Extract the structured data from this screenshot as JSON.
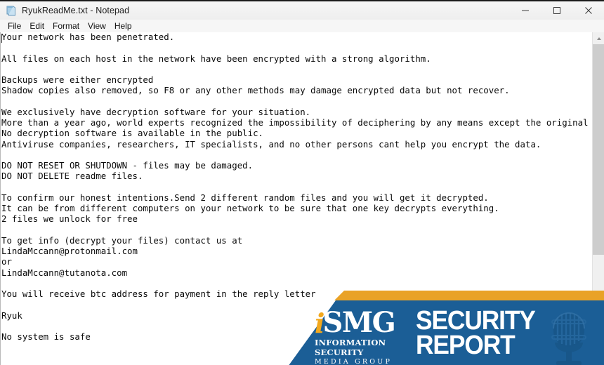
{
  "window": {
    "title": "RyukReadMe.txt - Notepad",
    "icon": "notepad-document-icon",
    "controls": {
      "minimize": "minimize-icon",
      "maximize": "maximize-icon",
      "close": "close-icon"
    }
  },
  "menu": {
    "items": [
      {
        "label": "File"
      },
      {
        "label": "Edit"
      },
      {
        "label": "Format"
      },
      {
        "label": "View"
      },
      {
        "label": "Help"
      }
    ]
  },
  "document": {
    "content": "Your network has been penetrated.\n\nAll files on each host in the network have been encrypted with a strong algorithm.\n\nBackups were either encrypted\nShadow copies also removed, so F8 or any other methods may damage encrypted data but not recover.\n\nWe exclusively have decryption software for your situation.\nMore than a year ago, world experts recognized the impossibility of deciphering by any means except the original decoder.\nNo decryption software is available in the public.\nAntiviruse companies, researchers, IT specialists, and no other persons cant help you encrypt the data.\n\nDO NOT RESET OR SHUTDOWN - files may be damaged.\nDO NOT DELETE readme files.\n\nTo confirm our honest intentions.Send 2 different random files and you will get it decrypted.\nIt can be from different computers on your network to be sure that one key decrypts everything.\n2 files we unlock for free\n\nTo get info (decrypt your files) contact us at\nLindaMccann@protonmail.com\nor\nLindaMccann@tutanota.com\n\nYou will receive btc address for payment in the reply letter\n\nRyuk\n\nNo system is safe",
    "lines": [
      "Your network has been penetrated.",
      "",
      "All files on each host in the network have been encrypted with a strong algorithm.",
      "",
      "Backups were either encrypted",
      "Shadow copies also removed, so F8 or any other methods may damage encrypted data but not recover.",
      "",
      "We exclusively have decryption software for your situation.",
      "More than a year ago, world experts recognized the impossibility of deciphering by any means except the original decoder.",
      "No decryption software is available in the public.",
      "Antiviruse companies, researchers, IT specialists, and no other persons cant help you encrypt the data.",
      "",
      "DO NOT RESET OR SHUTDOWN - files may be damaged.",
      "DO NOT DELETE readme files.",
      "",
      "To confirm our honest intentions.Send 2 different random files and you will get it decrypted.",
      "It can be from different computers on your network to be sure that one key decrypts everything.",
      "2 files we unlock for free",
      "",
      "To get info (decrypt your files) contact us at",
      "LindaMccann@protonmail.com",
      "or",
      "LindaMccann@tutanota.com",
      "",
      "You will receive btc address for payment in the reply letter",
      "",
      "Ryuk",
      "",
      "No system is safe"
    ],
    "contacts": [
      "LindaMccann@protonmail.com",
      "LindaMccann@tutanota.com"
    ],
    "signature": "Ryuk"
  },
  "scrollbar": {
    "up_arrow": "scroll-up-icon",
    "down_arrow": "scroll-down-icon"
  },
  "overlay": {
    "brand_i": "i",
    "brand_smg": "SMG",
    "tagline_line1": "INFORMATION SECURITY",
    "tagline_line2": "MEDIA GROUP",
    "report_line1": "SECURITY",
    "report_line2": "REPORT",
    "microphone": "microphone-icon",
    "colors": {
      "orange": "#E9A227",
      "blue": "#1B5E96",
      "gold": "#F2A81D",
      "white": "#FFFFFF"
    }
  }
}
